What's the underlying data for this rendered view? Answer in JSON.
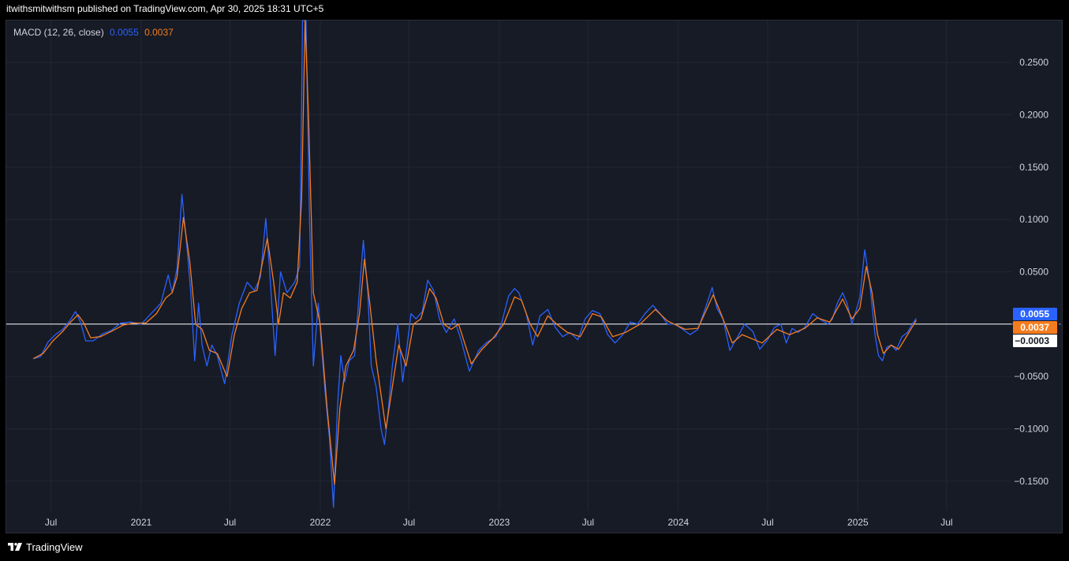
{
  "header": {
    "text": "itwithsmitwithsm published on TradingView.com, Apr 30, 2025 18:31 UTC+5"
  },
  "legend": {
    "label": "MACD (12, 26, close)",
    "macd_value": "0.0055",
    "signal_value": "0.0037"
  },
  "footer": {
    "brand": "TradingView",
    "logo_icon": "tradingview-logo-icon"
  },
  "colors": {
    "macd": "#2962ff",
    "signal": "#f57c1e",
    "zero": "#ffffff",
    "grid": "#232734",
    "background": "#171b26"
  },
  "chart_data": {
    "type": "line",
    "title": "MACD (12, 26, close)",
    "ylim": [
      -0.178,
      0.29
    ],
    "y_ticks": [
      0.25,
      0.2,
      0.15,
      0.1,
      0.05,
      -0.05,
      -0.1,
      -0.15
    ],
    "y_tick_labels": [
      "0.2500",
      "0.2000",
      "0.1500",
      "0.1000",
      "0.0500",
      "−0.0500",
      "−0.1000",
      "−0.1500"
    ],
    "x_range": [
      "2020-04-01",
      "2025-11-10"
    ],
    "x_ticks": [
      {
        "date": "2020-07-01",
        "label": "Jul"
      },
      {
        "date": "2021-01-01",
        "label": "2021"
      },
      {
        "date": "2021-07-01",
        "label": "Jul"
      },
      {
        "date": "2022-01-01",
        "label": "2022"
      },
      {
        "date": "2022-07-01",
        "label": "Jul"
      },
      {
        "date": "2023-01-01",
        "label": "2023"
      },
      {
        "date": "2023-07-01",
        "label": "Jul"
      },
      {
        "date": "2024-01-01",
        "label": "2024"
      },
      {
        "date": "2024-07-01",
        "label": "Jul"
      },
      {
        "date": "2025-01-01",
        "label": "2025"
      },
      {
        "date": "2025-07-01",
        "label": "Jul"
      }
    ],
    "grid": true,
    "zero_line": 0,
    "price_labels": [
      {
        "value": 0.0055,
        "label": "0.0055",
        "series": "MACD"
      },
      {
        "value": 0.0037,
        "label": "0.0037",
        "series": "Signal"
      },
      {
        "value": -0.0003,
        "label": "−0.0003",
        "series": "Histogram"
      }
    ],
    "series": [
      {
        "name": "MACD",
        "color": "#2962ff",
        "points": [
          [
            "2020-05-26",
            -0.033
          ],
          [
            "2020-06-10",
            -0.031
          ],
          [
            "2020-06-25",
            -0.017
          ],
          [
            "2020-07-10",
            -0.01
          ],
          [
            "2020-07-25",
            -0.005
          ],
          [
            "2020-08-08",
            0.003
          ],
          [
            "2020-08-20",
            0.012
          ],
          [
            "2020-08-30",
            0.002
          ],
          [
            "2020-09-10",
            -0.016
          ],
          [
            "2020-09-25",
            -0.016
          ],
          [
            "2020-10-15",
            -0.009
          ],
          [
            "2020-11-01",
            -0.006
          ],
          [
            "2020-11-20",
            0.001
          ],
          [
            "2020-12-10",
            0.002
          ],
          [
            "2021-01-01",
            0.0
          ],
          [
            "2021-01-25",
            0.012
          ],
          [
            "2021-02-10",
            0.02
          ],
          [
            "2021-02-25",
            0.047
          ],
          [
            "2021-03-05",
            0.03
          ],
          [
            "2021-03-15",
            0.053
          ],
          [
            "2021-03-25",
            0.124
          ],
          [
            "2021-04-05",
            0.07
          ],
          [
            "2021-04-12",
            0.03
          ],
          [
            "2021-04-20",
            -0.035
          ],
          [
            "2021-04-28",
            0.02
          ],
          [
            "2021-05-05",
            -0.02
          ],
          [
            "2021-05-15",
            -0.04
          ],
          [
            "2021-05-25",
            -0.02
          ],
          [
            "2021-06-05",
            -0.03
          ],
          [
            "2021-06-20",
            -0.057
          ],
          [
            "2021-07-05",
            -0.01
          ],
          [
            "2021-07-20",
            0.02
          ],
          [
            "2021-08-05",
            0.04
          ],
          [
            "2021-08-20",
            0.032
          ],
          [
            "2021-09-01",
            0.045
          ],
          [
            "2021-09-12",
            0.101
          ],
          [
            "2021-09-20",
            0.05
          ],
          [
            "2021-10-01",
            -0.03
          ],
          [
            "2021-10-12",
            0.05
          ],
          [
            "2021-10-25",
            0.03
          ],
          [
            "2021-11-10",
            0.04
          ],
          [
            "2021-11-20",
            0.055
          ],
          [
            "2021-11-26",
            0.29
          ],
          [
            "2021-12-03",
            0.29
          ],
          [
            "2021-12-10",
            0.1
          ],
          [
            "2021-12-18",
            -0.04
          ],
          [
            "2021-12-28",
            0.02
          ],
          [
            "2022-01-10",
            -0.06
          ],
          [
            "2022-01-20",
            -0.11
          ],
          [
            "2022-01-28",
            -0.175
          ],
          [
            "2022-02-05",
            -0.08
          ],
          [
            "2022-02-12",
            -0.03
          ],
          [
            "2022-02-20",
            -0.055
          ],
          [
            "2022-03-01",
            -0.035
          ],
          [
            "2022-03-12",
            -0.03
          ],
          [
            "2022-03-20",
            0.02
          ],
          [
            "2022-03-30",
            0.08
          ],
          [
            "2022-04-08",
            0.03
          ],
          [
            "2022-04-15",
            -0.04
          ],
          [
            "2022-04-25",
            -0.06
          ],
          [
            "2022-05-05",
            -0.1
          ],
          [
            "2022-05-12",
            -0.115
          ],
          [
            "2022-05-20",
            -0.08
          ],
          [
            "2022-05-28",
            -0.04
          ],
          [
            "2022-06-08",
            0.0
          ],
          [
            "2022-06-18",
            -0.055
          ],
          [
            "2022-07-05",
            0.01
          ],
          [
            "2022-07-15",
            0.005
          ],
          [
            "2022-07-28",
            0.012
          ],
          [
            "2022-08-08",
            0.042
          ],
          [
            "2022-08-20",
            0.032
          ],
          [
            "2022-09-01",
            0.005
          ],
          [
            "2022-09-15",
            -0.008
          ],
          [
            "2022-10-01",
            0.005
          ],
          [
            "2022-10-15",
            -0.015
          ],
          [
            "2022-11-01",
            -0.045
          ],
          [
            "2022-11-20",
            -0.025
          ],
          [
            "2022-12-05",
            -0.018
          ],
          [
            "2022-12-25",
            -0.012
          ],
          [
            "2023-01-05",
            0.0
          ],
          [
            "2023-01-20",
            0.027
          ],
          [
            "2023-02-01",
            0.034
          ],
          [
            "2023-02-10",
            0.03
          ],
          [
            "2023-02-25",
            0.01
          ],
          [
            "2023-03-10",
            -0.02
          ],
          [
            "2023-03-25",
            0.008
          ],
          [
            "2023-04-10",
            0.014
          ],
          [
            "2023-04-25",
            -0.003
          ],
          [
            "2023-05-10",
            -0.012
          ],
          [
            "2023-05-25",
            -0.008
          ],
          [
            "2023-06-10",
            -0.015
          ],
          [
            "2023-06-25",
            0.005
          ],
          [
            "2023-07-10",
            0.013
          ],
          [
            "2023-07-25",
            0.01
          ],
          [
            "2023-08-10",
            -0.01
          ],
          [
            "2023-08-25",
            -0.018
          ],
          [
            "2023-09-10",
            -0.01
          ],
          [
            "2023-09-25",
            0.002
          ],
          [
            "2023-10-10",
            0.0
          ],
          [
            "2023-10-25",
            0.01
          ],
          [
            "2023-11-10",
            0.018
          ],
          [
            "2023-11-25",
            0.01
          ],
          [
            "2023-12-10",
            0.0
          ],
          [
            "2023-12-25",
            0.0
          ],
          [
            "2024-01-10",
            -0.005
          ],
          [
            "2024-01-25",
            -0.01
          ],
          [
            "2024-02-10",
            -0.005
          ],
          [
            "2024-02-25",
            0.015
          ],
          [
            "2024-03-10",
            0.035
          ],
          [
            "2024-03-20",
            0.015
          ],
          [
            "2024-04-01",
            0.005
          ],
          [
            "2024-04-15",
            -0.025
          ],
          [
            "2024-05-01",
            -0.012
          ],
          [
            "2024-05-15",
            0.0
          ],
          [
            "2024-06-01",
            -0.007
          ],
          [
            "2024-06-15",
            -0.024
          ],
          [
            "2024-07-01",
            -0.015
          ],
          [
            "2024-07-15",
            -0.003
          ],
          [
            "2024-07-28",
            0.0
          ],
          [
            "2024-08-08",
            -0.018
          ],
          [
            "2024-08-20",
            -0.004
          ],
          [
            "2024-09-01",
            -0.008
          ],
          [
            "2024-09-15",
            -0.003
          ],
          [
            "2024-10-01",
            0.01
          ],
          [
            "2024-10-15",
            0.005
          ],
          [
            "2024-11-01",
            0.0
          ],
          [
            "2024-11-10",
            0.005
          ],
          [
            "2024-11-20",
            0.02
          ],
          [
            "2024-12-01",
            0.03
          ],
          [
            "2024-12-10",
            0.02
          ],
          [
            "2024-12-20",
            0.0
          ],
          [
            "2025-01-05",
            0.025
          ],
          [
            "2025-01-15",
            0.071
          ],
          [
            "2025-01-25",
            0.04
          ],
          [
            "2025-02-05",
            -0.01
          ],
          [
            "2025-02-12",
            -0.03
          ],
          [
            "2025-02-20",
            -0.035
          ],
          [
            "2025-03-01",
            -0.022
          ],
          [
            "2025-03-10",
            -0.02
          ],
          [
            "2025-03-20",
            -0.025
          ],
          [
            "2025-04-01",
            -0.012
          ],
          [
            "2025-04-12",
            -0.008
          ],
          [
            "2025-04-22",
            0.0
          ],
          [
            "2025-04-30",
            0.0055
          ]
        ]
      },
      {
        "name": "Signal",
        "color": "#f57c1e",
        "points": [
          [
            "2020-05-26",
            -0.033
          ],
          [
            "2020-06-15",
            -0.028
          ],
          [
            "2020-07-05",
            -0.016
          ],
          [
            "2020-07-25",
            -0.007
          ],
          [
            "2020-08-10",
            0.002
          ],
          [
            "2020-08-25",
            0.009
          ],
          [
            "2020-09-05",
            0.002
          ],
          [
            "2020-09-20",
            -0.013
          ],
          [
            "2020-10-10",
            -0.012
          ],
          [
            "2020-11-01",
            -0.007
          ],
          [
            "2020-11-25",
            -0.001
          ],
          [
            "2020-12-15",
            0.001
          ],
          [
            "2021-01-10",
            0.001
          ],
          [
            "2021-02-01",
            0.01
          ],
          [
            "2021-02-20",
            0.025
          ],
          [
            "2021-03-05",
            0.03
          ],
          [
            "2021-03-15",
            0.045
          ],
          [
            "2021-03-28",
            0.102
          ],
          [
            "2021-04-10",
            0.06
          ],
          [
            "2021-04-22",
            0.0
          ],
          [
            "2021-05-05",
            -0.005
          ],
          [
            "2021-05-20",
            -0.025
          ],
          [
            "2021-06-05",
            -0.028
          ],
          [
            "2021-06-25",
            -0.05
          ],
          [
            "2021-07-10",
            -0.01
          ],
          [
            "2021-07-25",
            0.015
          ],
          [
            "2021-08-10",
            0.03
          ],
          [
            "2021-08-25",
            0.032
          ],
          [
            "2021-09-15",
            0.082
          ],
          [
            "2021-09-28",
            0.04
          ],
          [
            "2021-10-08",
            0.0
          ],
          [
            "2021-10-18",
            0.03
          ],
          [
            "2021-11-01",
            0.025
          ],
          [
            "2021-11-15",
            0.04
          ],
          [
            "2021-11-24",
            0.12
          ],
          [
            "2021-12-01",
            0.29
          ],
          [
            "2021-12-08",
            0.2
          ],
          [
            "2021-12-18",
            0.03
          ],
          [
            "2022-01-01",
            0.0
          ],
          [
            "2022-01-15",
            -0.08
          ],
          [
            "2022-01-30",
            -0.153
          ],
          [
            "2022-02-10",
            -0.08
          ],
          [
            "2022-02-22",
            -0.04
          ],
          [
            "2022-03-10",
            -0.025
          ],
          [
            "2022-03-22",
            0.01
          ],
          [
            "2022-04-01",
            0.062
          ],
          [
            "2022-04-12",
            0.02
          ],
          [
            "2022-04-25",
            -0.035
          ],
          [
            "2022-05-15",
            -0.1
          ],
          [
            "2022-05-28",
            -0.06
          ],
          [
            "2022-06-10",
            -0.02
          ],
          [
            "2022-06-25",
            -0.04
          ],
          [
            "2022-07-10",
            0.0
          ],
          [
            "2022-07-25",
            0.005
          ],
          [
            "2022-08-12",
            0.034
          ],
          [
            "2022-08-25",
            0.025
          ],
          [
            "2022-09-10",
            0.0
          ],
          [
            "2022-09-25",
            -0.005
          ],
          [
            "2022-10-10",
            0.0
          ],
          [
            "2022-11-05",
            -0.038
          ],
          [
            "2022-11-25",
            -0.025
          ],
          [
            "2022-12-20",
            -0.013
          ],
          [
            "2023-01-10",
            0.0
          ],
          [
            "2023-02-01",
            0.026
          ],
          [
            "2023-02-15",
            0.023
          ],
          [
            "2023-03-05",
            0.0
          ],
          [
            "2023-03-20",
            -0.012
          ],
          [
            "2023-04-10",
            0.008
          ],
          [
            "2023-04-28",
            0.0
          ],
          [
            "2023-05-20",
            -0.008
          ],
          [
            "2023-06-15",
            -0.012
          ],
          [
            "2023-07-10",
            0.01
          ],
          [
            "2023-07-28",
            0.007
          ],
          [
            "2023-08-20",
            -0.012
          ],
          [
            "2023-09-15",
            -0.008
          ],
          [
            "2023-10-15",
            0.0
          ],
          [
            "2023-11-15",
            0.014
          ],
          [
            "2023-12-10",
            0.003
          ],
          [
            "2024-01-15",
            -0.005
          ],
          [
            "2024-02-10",
            -0.004
          ],
          [
            "2024-03-12",
            0.028
          ],
          [
            "2024-03-28",
            0.01
          ],
          [
            "2024-04-20",
            -0.018
          ],
          [
            "2024-05-10",
            -0.01
          ],
          [
            "2024-06-20",
            -0.018
          ],
          [
            "2024-07-20",
            -0.005
          ],
          [
            "2024-08-15",
            -0.01
          ],
          [
            "2024-09-15",
            -0.004
          ],
          [
            "2024-10-10",
            0.006
          ],
          [
            "2024-11-05",
            0.002
          ],
          [
            "2024-12-01",
            0.024
          ],
          [
            "2024-12-20",
            0.005
          ],
          [
            "2025-01-05",
            0.015
          ],
          [
            "2025-01-18",
            0.055
          ],
          [
            "2025-01-30",
            0.03
          ],
          [
            "2025-02-10",
            -0.01
          ],
          [
            "2025-02-22",
            -0.028
          ],
          [
            "2025-03-10",
            -0.02
          ],
          [
            "2025-03-25",
            -0.024
          ],
          [
            "2025-04-10",
            -0.012
          ],
          [
            "2025-04-30",
            0.0037
          ]
        ]
      }
    ]
  }
}
